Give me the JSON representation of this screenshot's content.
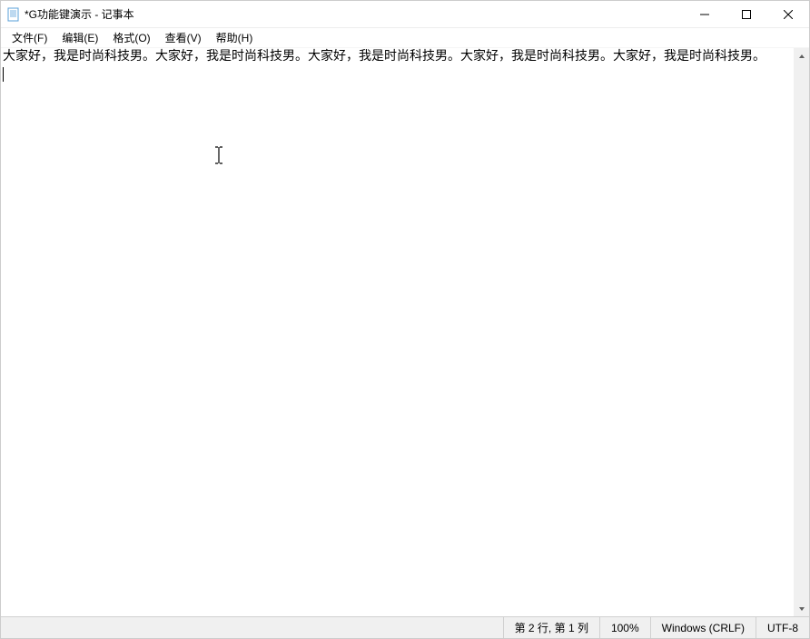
{
  "window": {
    "title": "*G功能键演示 - 记事本"
  },
  "menubar": {
    "file": "文件(F)",
    "edit": "编辑(E)",
    "format": "格式(O)",
    "view": "查看(V)",
    "help": "帮助(H)"
  },
  "content": {
    "text": "大家好，我是时尚科技男。大家好，我是时尚科技男。大家好，我是时尚科技男。大家好，我是时尚科技男。大家好，我是时尚科技男。"
  },
  "statusbar": {
    "position": "第 2 行, 第 1 列",
    "zoom": "100%",
    "line_ending": "Windows (CRLF)",
    "encoding": "UTF-8"
  }
}
